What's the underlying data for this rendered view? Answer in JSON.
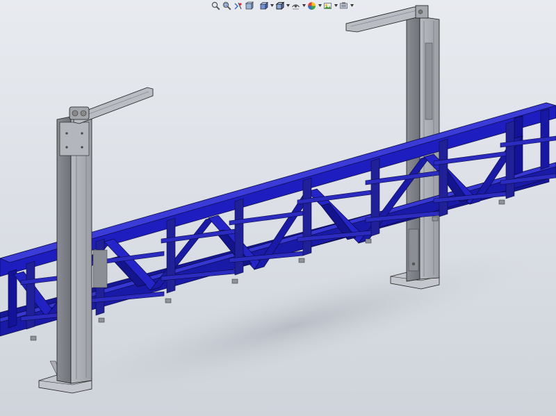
{
  "app": {
    "window_type": "cad-3d-viewport"
  },
  "colors": {
    "background_top": "#e8ebf0",
    "background_bottom": "#cfd4db",
    "truss_blue": "#1a1aa8",
    "truss_dark": "#0b0b6e",
    "truss_light": "#3a3ad0",
    "column_gray": "#a9acb3",
    "column_dark": "#7d8088",
    "column_light": "#c9ccd2",
    "edge": "#1c1c1c"
  },
  "toolbar": {
    "items": [
      {
        "icon": "zoom-to-fit-icon",
        "has_dropdown": false
      },
      {
        "icon": "zoom-to-area-icon",
        "has_dropdown": false
      },
      {
        "icon": "previous-view-icon",
        "has_dropdown": false
      },
      {
        "icon": "section-view-icon",
        "has_dropdown": false
      },
      {
        "icon": "view-orientation-icon",
        "has_dropdown": true
      },
      {
        "icon": "display-style-icon",
        "has_dropdown": true
      },
      {
        "icon": "hide-show-items-icon",
        "has_dropdown": true
      },
      {
        "icon": "edit-appearance-icon",
        "has_dropdown": true
      },
      {
        "icon": "apply-scene-icon",
        "has_dropdown": true
      },
      {
        "icon": "view-settings-icon",
        "has_dropdown": true
      }
    ]
  }
}
